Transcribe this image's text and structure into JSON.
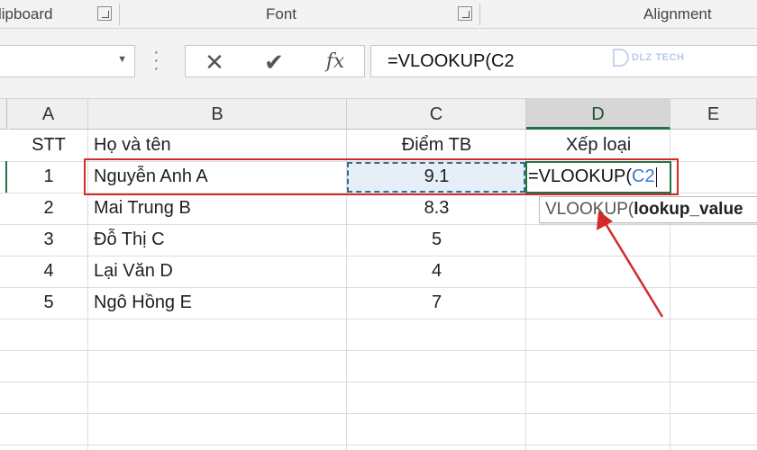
{
  "ribbon": {
    "clipboard_label": "lipboard",
    "font_label": "Font",
    "alignment_label": "Alignment"
  },
  "formula_bar": {
    "cancel_glyph": "✕",
    "enter_glyph": "✔",
    "fx_glyph": "fx",
    "formula": "=VLOOKUP(C2"
  },
  "watermark": {
    "text": "DLZ TECH"
  },
  "columns": [
    "A",
    "B",
    "C",
    "D",
    "E"
  ],
  "table": {
    "headers": {
      "a": "STT",
      "b": "Họ và tên",
      "c": "Điểm TB",
      "d": "Xếp loại"
    },
    "rows": [
      {
        "stt": "1",
        "name": "Nguyễn Anh A",
        "score": "9.1"
      },
      {
        "stt": "2",
        "name": "Mai Trung B",
        "score": "8.3"
      },
      {
        "stt": "3",
        "name": "Đỗ Thị C",
        "score": "5"
      },
      {
        "stt": "4",
        "name": "Lại Văn D",
        "score": "4"
      },
      {
        "stt": "5",
        "name": "Ngô Hồng E",
        "score": "7"
      }
    ]
  },
  "editing_cell": {
    "prefix": "=VLOOKUP(",
    "ref": "C2"
  },
  "tooltip": {
    "func": "VLOOKUP(",
    "arg": "lookup_value"
  },
  "colors": {
    "highlight_red": "#d12b2b",
    "active_green": "#217346",
    "ref_blue": "#3a7bd5"
  }
}
